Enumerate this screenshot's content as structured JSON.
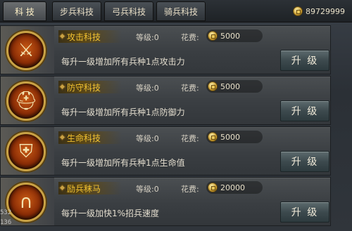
{
  "tabs": [
    {
      "label": "科 技",
      "active": true
    },
    {
      "label": "步兵科技",
      "active": false
    },
    {
      "label": "弓兵科技",
      "active": false
    },
    {
      "label": "骑兵科技",
      "active": false
    }
  ],
  "currency": {
    "icon": "coin-icon",
    "amount": "89729999"
  },
  "techs": [
    {
      "icon": "axe-icon",
      "name": "攻击科技",
      "level": "等级:0",
      "cost_label": "花费:",
      "cost": "5000",
      "description": "每升一级增加所有兵种1点攻击力",
      "button": "升 级"
    },
    {
      "icon": "helmet-icon",
      "name": "防守科技",
      "level": "等级:0",
      "cost_label": "花费:",
      "cost": "5000",
      "description": "每升一级增加所有兵种1点防御力",
      "button": "升 级"
    },
    {
      "icon": "armor-icon",
      "name": "生命科技",
      "level": "等级:0",
      "cost_label": "花费:",
      "cost": "5000",
      "description": "每升一级增加所有兵种1点生命值",
      "button": "升 级"
    },
    {
      "icon": "horseshoe-icon",
      "name": "励兵秣马",
      "level": "等级:0",
      "cost_label": "花费:",
      "cost": "20000",
      "description": "每升一级加快1%招兵速度",
      "button": "升 级"
    }
  ],
  "side_numbers": [
    "532",
    "136"
  ]
}
